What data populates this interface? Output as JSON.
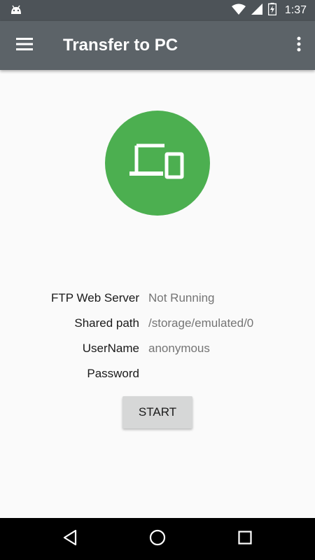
{
  "status_bar": {
    "time": "1:37",
    "icons": [
      "android-icon",
      "wifi-icon",
      "signal-icon",
      "battery-charging-icon"
    ]
  },
  "app_bar": {
    "title": "Transfer to PC",
    "icons": [
      "menu-icon",
      "more-vert-icon"
    ]
  },
  "hero": {
    "icon": "devices-icon",
    "color": "#4caf50"
  },
  "info": {
    "rows": [
      {
        "label": "FTP Web Server",
        "value": "Not Running"
      },
      {
        "label": "Shared path",
        "value": "/storage/emulated/0"
      },
      {
        "label": "UserName",
        "value": "anonymous"
      },
      {
        "label": "Password",
        "value": ""
      }
    ]
  },
  "start_button": {
    "label": "START"
  },
  "nav_bar": {
    "icons": [
      "back-icon",
      "home-icon",
      "recents-icon"
    ]
  },
  "colors": {
    "app_bar": "#5c6368",
    "status_bar": "#4d5358",
    "accent": "#4caf50",
    "background": "#fafafa"
  }
}
